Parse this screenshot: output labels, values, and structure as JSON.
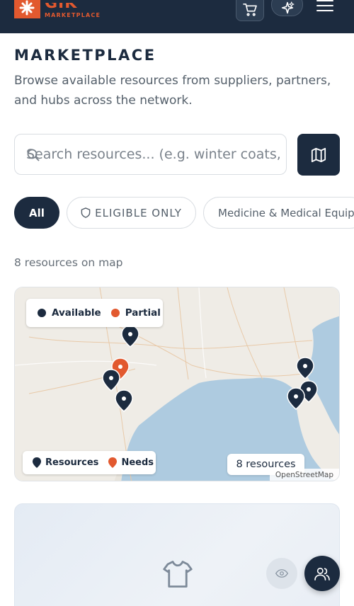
{
  "header": {
    "logo_text": "GIK",
    "logo_subtext": "MARKETPLACE",
    "icons": [
      "cart-icon",
      "sparkle-icon",
      "menu-icon"
    ]
  },
  "page": {
    "title": "MARKETPLACE",
    "subtitle": "Browse available resources from suppliers, partners, and hubs across the network."
  },
  "search": {
    "placeholder": "Search resources... (e.g. winter coats, medical supplies)",
    "value": ""
  },
  "filters": {
    "all_label": "All",
    "eligible_label": "ELIGIBLE ONLY",
    "category_label": "Medicine & Medical Equipment"
  },
  "results": {
    "count_text": "8 resources on map"
  },
  "map": {
    "legend_available": "Available",
    "legend_partial": "Partial",
    "legend_resources": "Resources",
    "legend_needs": "Needs",
    "resource_count": "8 resources",
    "attribution": "OpenStreetMap",
    "colors": {
      "available": "#1c2b3f",
      "partial": "#e2592f",
      "water": "#aecbe0",
      "land": "#efece6"
    }
  }
}
